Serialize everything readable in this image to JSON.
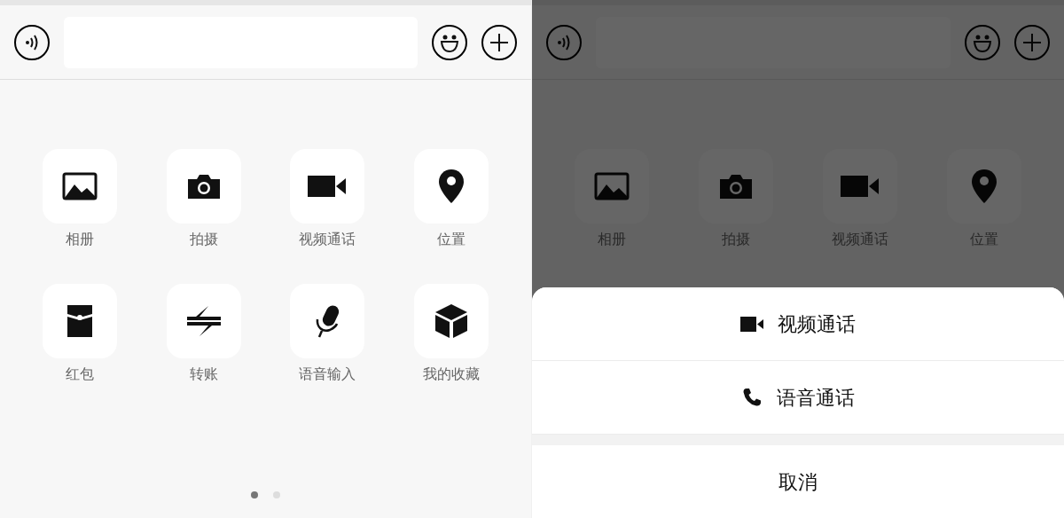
{
  "panels": [
    {
      "dimmed": false,
      "apps": [
        {
          "label": "相册"
        },
        {
          "label": "拍摄"
        },
        {
          "label": "视频通话"
        },
        {
          "label": "位置"
        },
        {
          "label": "红包"
        },
        {
          "label": "转账"
        },
        {
          "label": "语音输入"
        },
        {
          "label": "我的收藏"
        }
      ],
      "page_dots": [
        {
          "selected": true
        },
        {
          "selected": false
        }
      ]
    },
    {
      "dimmed": true,
      "apps": [
        {
          "label": "相册"
        },
        {
          "label": "拍摄"
        },
        {
          "label": "视频通话"
        },
        {
          "label": "位置"
        }
      ],
      "action_sheet": {
        "options": [
          "视频通话",
          "语音通话"
        ],
        "cancel": "取消"
      }
    }
  ]
}
